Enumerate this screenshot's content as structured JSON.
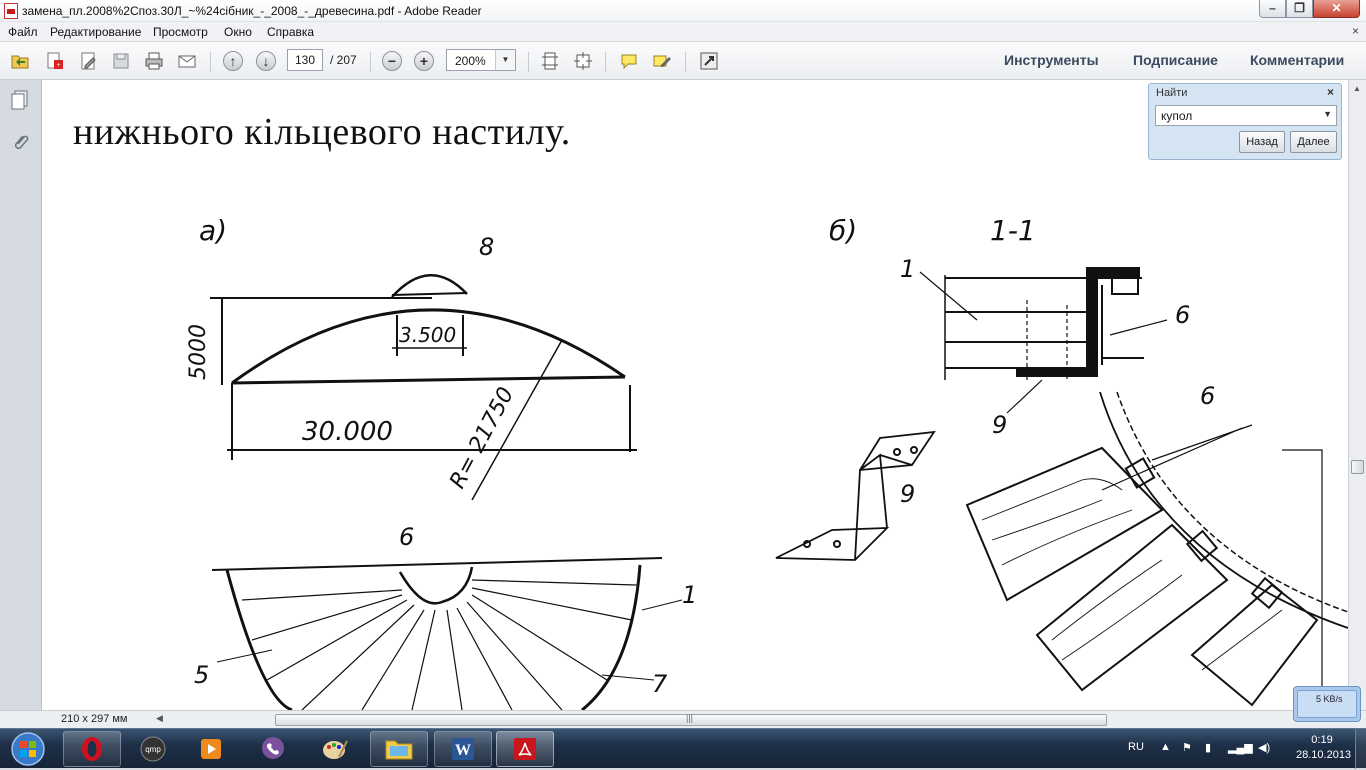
{
  "window": {
    "title": "замена_пл.2008%2Споз.30Л_~%24сібник_-_2008_-_древесина.pdf - Adobe Reader",
    "minimize_icon": "minimize-icon",
    "maximize_icon": "maximize-icon",
    "close_icon": "close-icon"
  },
  "menu": {
    "items": [
      "Файл",
      "Редактирование",
      "Просмотр",
      "Окно",
      "Справка"
    ],
    "close_glyph": "×"
  },
  "toolbar": {
    "page_current": "130",
    "page_total": "/ 207",
    "zoom": "200%",
    "right_panels": [
      "Инструменты",
      "Подписание",
      "Комментарии"
    ]
  },
  "document": {
    "text_line": "нижнього кільцевого настилу.",
    "figure_labels": {
      "part_a": "а)",
      "part_b": "б)",
      "section": "1-1",
      "height": "5000",
      "span": "30.000",
      "inner": "3.500",
      "radius": "R= 21750",
      "n8": "8",
      "n6_top": "6",
      "n1": "1",
      "n5": "5",
      "n7": "7",
      "n1b": "1",
      "n6b": "6",
      "n9a": "9",
      "n6c": "6",
      "n9b": "9"
    },
    "page_size": "210 x 297 мм"
  },
  "find": {
    "label": "Найти",
    "query": "купол",
    "back_label": "Назад",
    "next_label": "Далее"
  },
  "network": {
    "speed": "5 KB/s"
  },
  "taskbar": {
    "apps": [
      "opera",
      "gom-player",
      "media-player",
      "viber",
      "paint",
      "file-explorer",
      "word",
      "adobe-reader"
    ],
    "language": "RU",
    "time": "0:19",
    "date": "28.10.2013"
  }
}
